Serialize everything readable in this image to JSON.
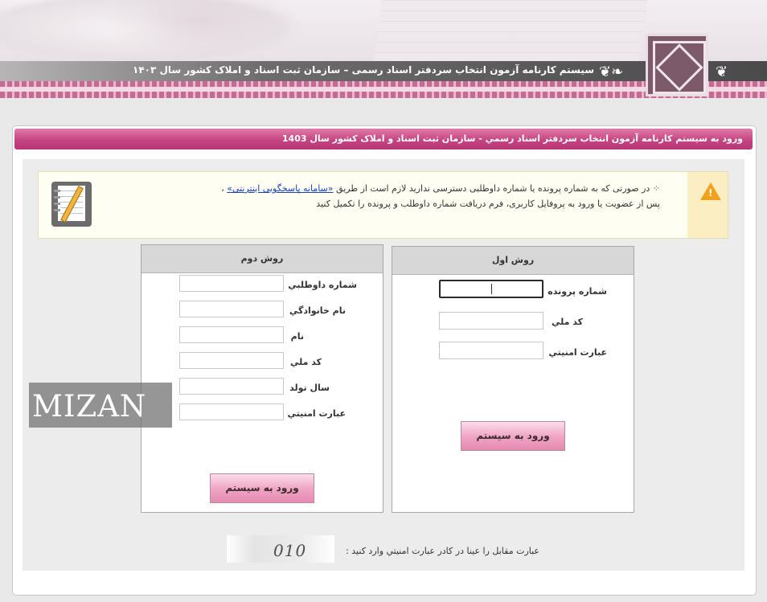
{
  "header": {
    "title": "سیستم کارنامه آزمون انتخاب سردفتر اسناد رسمی – سازمان ثبت اسناد و املاک کشور سال ۱۴۰۳"
  },
  "panel": {
    "title": "ورود به سیستم کارنامه آزمون انتخاب سردفتر اسناد رسمي - سازمان ثبت اسناد و املاک کشور سال 1403"
  },
  "notice": {
    "line1_prefix": "در صورتی که به شماره پرونده یا شماره داوطلبی دسترسی ندارید لازم است از طریق",
    "link": "«سامانه پاسخگویی اینترنتی»",
    "line1_suffix": "،",
    "line2": "پس از عضویت یا ورود به پروفایل کاربری، فرم دریافت شماره داوطلب و پرونده را تکمیل کنید"
  },
  "method1": {
    "title": "روش اول",
    "file_number_label": "شماره پرونده",
    "national_code_label": "کد ملي",
    "security_label": "عبارت امنيتي",
    "file_number_value": "",
    "national_code_value": "",
    "security_value": "",
    "submit": "ورود به سيستم"
  },
  "method2": {
    "title": "روش دوم",
    "applicant_number_label": "شماره داوطلبي",
    "family_label": "نام خانوادگي",
    "name_label": "نام",
    "national_code_label": "کد ملي",
    "birth_year_label": "سال تولد",
    "security_label": "عبارت امنيتي",
    "applicant_number_value": "",
    "family_value": "",
    "name_value": "",
    "national_code_value": "",
    "birth_year_value": "",
    "security_value": "",
    "submit": "ورود به سيستم"
  },
  "captcha": {
    "label": "عبارت مقابل را عينا در کادر عبارت امنيتي وارد کنيد :",
    "text": "010"
  },
  "watermark": {
    "text": "MIZAN"
  },
  "colors": {
    "accent": "#c54583",
    "button": "#f0a7c6",
    "warning": "#f2a11a",
    "link": "#1a3fbf"
  },
  "icons": {
    "warning": "warning-triangle-icon",
    "notepad": "notepad-pencil-icon",
    "logo": "organization-logo"
  }
}
